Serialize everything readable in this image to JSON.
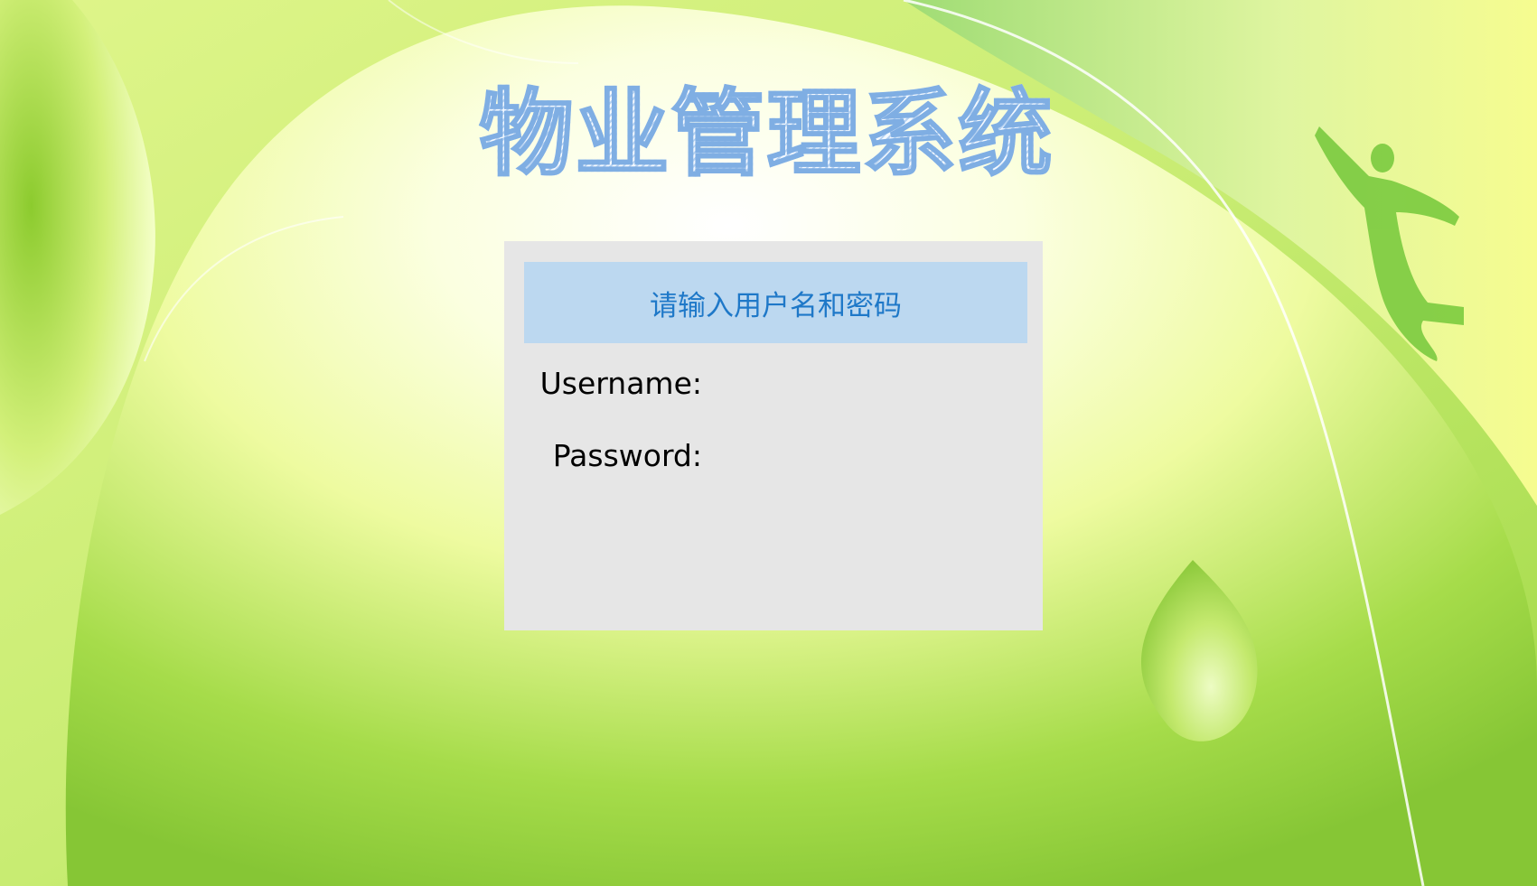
{
  "app": {
    "title": "物业管理系统"
  },
  "login_panel": {
    "header": "请输入用户名和密码",
    "username_label": "Username:",
    "password_label": "Password:",
    "username_value": "",
    "password_value": ""
  },
  "colors": {
    "panel_bg": "#e6e6e6",
    "header_bg": "#bcd8f0",
    "header_text": "#1e78c8",
    "title_outline": "#7faee3",
    "background_green": "#86c635",
    "background_light": "#f4ffb0"
  },
  "decorations": {
    "figure": "flying-person-silhouette",
    "drop": "water-drop"
  }
}
